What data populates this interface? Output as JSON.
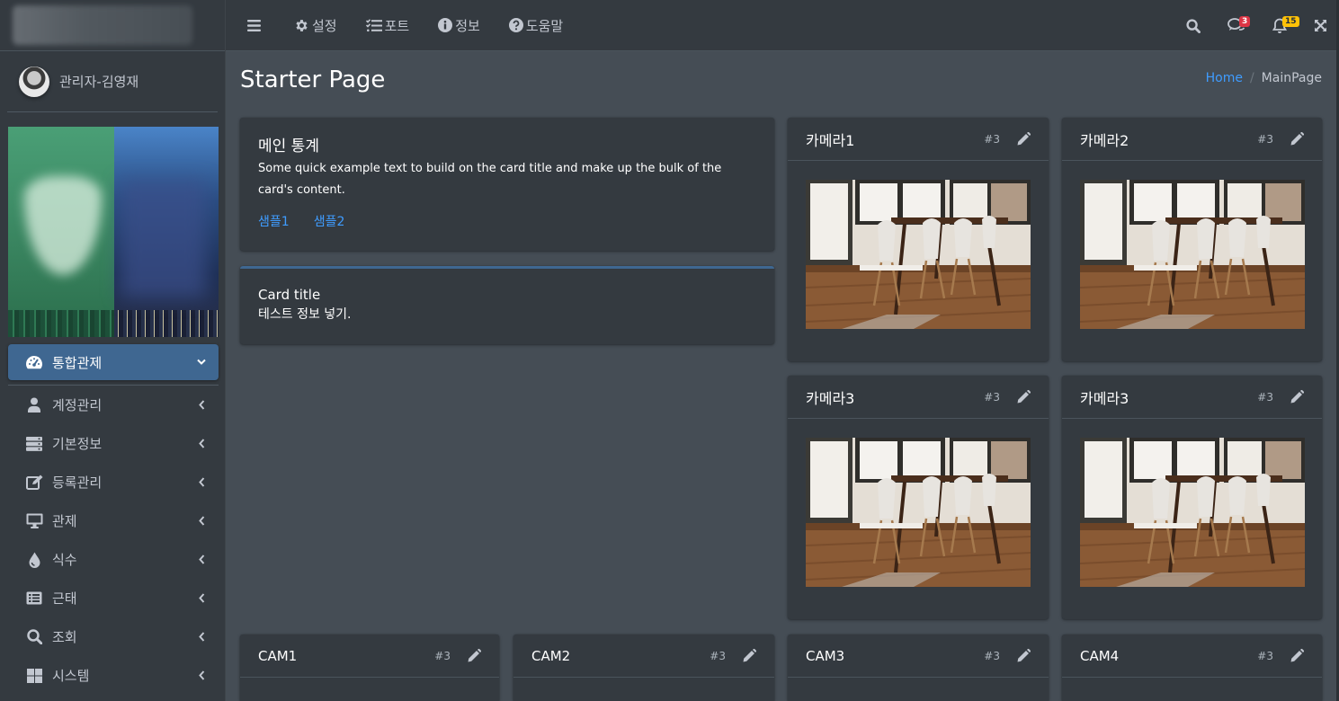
{
  "sidebar": {
    "user_name": "관리자-김영재",
    "items": [
      {
        "label": "통합관제",
        "icon": "dashboard-gauge-icon",
        "active": true
      },
      {
        "label": "계정관리",
        "icon": "user-icon"
      },
      {
        "label": "기본정보",
        "icon": "server-icon"
      },
      {
        "label": "등록관리",
        "icon": "edit-icon"
      },
      {
        "label": "관제",
        "icon": "monitor-icon"
      },
      {
        "label": "식수",
        "icon": "water-drop-icon"
      },
      {
        "label": "근태",
        "icon": "list-alt-icon"
      },
      {
        "label": "조회",
        "icon": "search-icon"
      },
      {
        "label": "시스템",
        "icon": "windows-grid-icon"
      }
    ]
  },
  "topbar": {
    "menu": [
      {
        "label": "설정",
        "icon": "gear-icon"
      },
      {
        "label": "포트",
        "icon": "tasks-icon"
      },
      {
        "label": "정보",
        "icon": "info-circle-icon"
      },
      {
        "label": "도움말",
        "icon": "question-circle-icon"
      }
    ],
    "messages_badge": "3",
    "notifications_badge": "15"
  },
  "content": {
    "title": "Starter Page",
    "breadcrumb": {
      "home": "Home",
      "separator": "/",
      "current": "MainPage"
    },
    "main_card": {
      "title": "메인 통계",
      "text": "Some quick example text to build on the card title and make up the bulk of the card's content.",
      "links": [
        "샘플1",
        "샘플2"
      ]
    },
    "info_card": {
      "title": "Card title",
      "text": "테스트 정보 넣기."
    },
    "camera_cards": [
      {
        "title": "카메라1",
        "num": "#3"
      },
      {
        "title": "카메라2",
        "num": "#3"
      },
      {
        "title": "카메라3",
        "num": "#3"
      },
      {
        "title": "카메라3",
        "num": "#3"
      }
    ],
    "cam_cards": [
      {
        "title": "CAM1",
        "num": "#3"
      },
      {
        "title": "CAM2",
        "num": "#3"
      },
      {
        "title": "CAM3",
        "num": "#3"
      },
      {
        "title": "CAM4",
        "num": "#3"
      }
    ]
  },
  "colors": {
    "sidebar_bg": "#343a40",
    "content_bg": "#454d55",
    "active_item": "#3f6791",
    "link": "#3f9cff",
    "badge_red": "#dc3545",
    "badge_yellow": "#ffc107"
  }
}
